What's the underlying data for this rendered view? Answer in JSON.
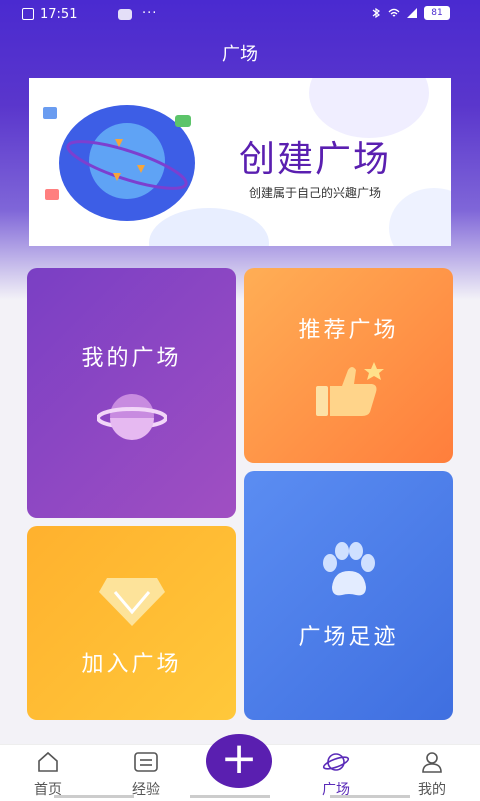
{
  "status_bar": {
    "time": "17:51",
    "battery": "81"
  },
  "page_title": "广场",
  "banner": {
    "heading": "创建广场",
    "subheading": "创建属于自己的兴趣广场"
  },
  "tiles": {
    "mine": "我的广场",
    "recommend": "推荐广场",
    "join": "加入广场",
    "footprint": "广场足迹"
  },
  "tab_bar": {
    "items": [
      {
        "label": "首页",
        "icon": "home-icon"
      },
      {
        "label": "经验",
        "icon": "list-icon"
      },
      {
        "label": "+",
        "icon": "plus-icon"
      },
      {
        "label": "广场",
        "icon": "planet-icon",
        "active": true
      },
      {
        "label": "我的",
        "icon": "user-icon"
      }
    ]
  },
  "colors": {
    "accent": "#5a1fb0",
    "header": "#4a2ad0",
    "tile_mine": "#8a45c3",
    "tile_recommend": "#ff8e45",
    "tile_join": "#ffbc33",
    "tile_footprint": "#4f7fea"
  }
}
